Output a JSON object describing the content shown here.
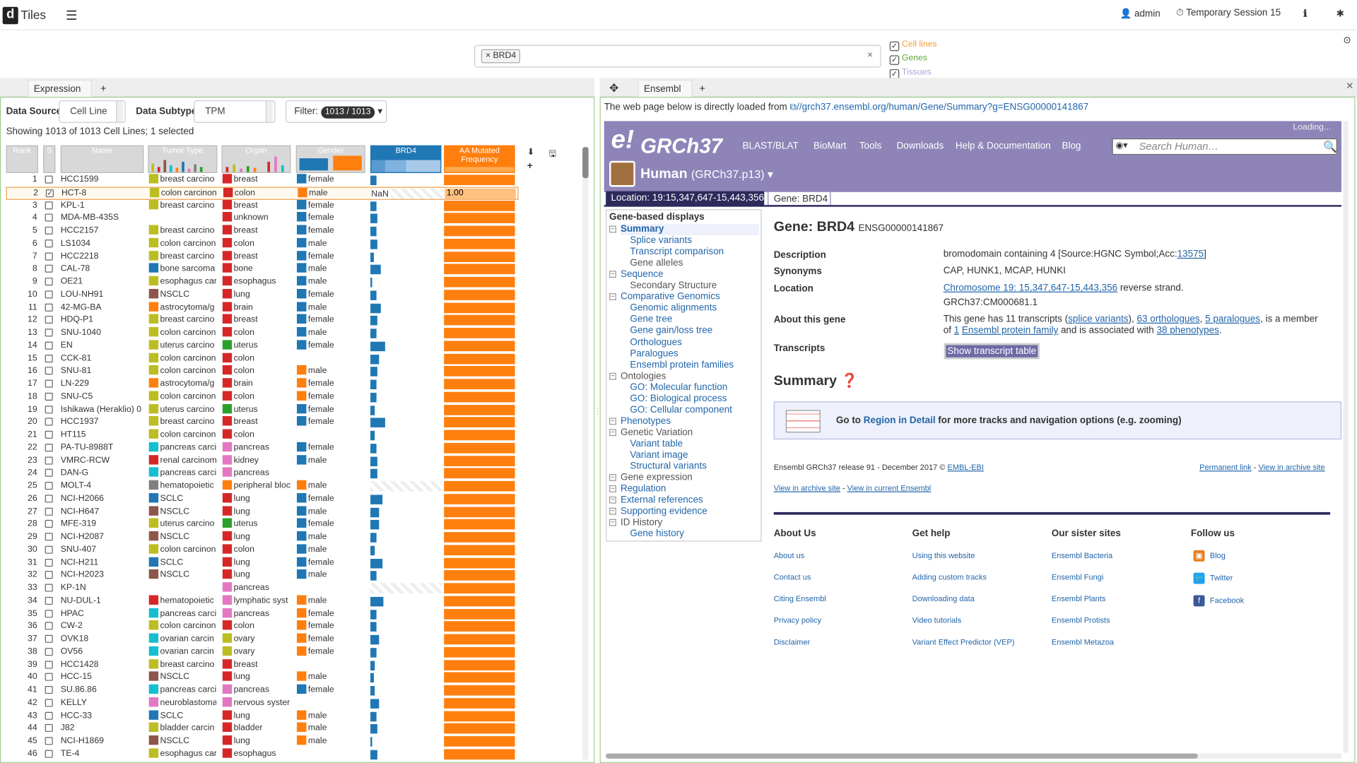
{
  "app": {
    "logo": "d",
    "title": "Tiles",
    "user": "admin",
    "session": "Temporary Session 15"
  },
  "search": {
    "chip": "× BRD4",
    "clear": "×"
  },
  "types": [
    {
      "label": "Cell lines",
      "color": "#f39c3a"
    },
    {
      "label": "Genes",
      "color": "#5aa832"
    },
    {
      "label": "Tissues",
      "color": "#b3a2d8"
    }
  ],
  "left": {
    "tab": "Expression",
    "tab_close": "×",
    "add_tab": "+",
    "datasource_label": "Data Source",
    "datasource_value": "Cell Line",
    "subtype_label": "Data Subtype",
    "subtype_value": "TPM",
    "filter_label": "Filter:",
    "filter_badge": "1013 / 1013",
    "showing": "Showing 1013 of 1013 Cell Lines; 1 selected",
    "columns": [
      "Rank",
      "S",
      "Name",
      "Tumor Type",
      "Organ",
      "Gender",
      "BRD4",
      "AA Mutated Frequency"
    ]
  },
  "rows": [
    {
      "rank": "1",
      "name": "HCC1599",
      "tumor": "breast carcino",
      "tc": "#bcbd22",
      "organ": "breast",
      "oc": "#d62728",
      "gender": "female",
      "gc": "#1f77b4",
      "brd4": 0.08
    },
    {
      "rank": "2",
      "name": "HCT-8",
      "tumor": "colon carcinon",
      "tc": "#bcbd22",
      "organ": "colon",
      "oc": "#d62728",
      "gender": "male",
      "gc": "#ff7f0e",
      "brd4": null,
      "freq": "1.00",
      "sel": true
    },
    {
      "rank": "3",
      "name": "KPL-1",
      "tumor": "breast carcino",
      "tc": "#bcbd22",
      "organ": "breast",
      "oc": "#d62728",
      "gender": "female",
      "gc": "#1f77b4",
      "brd4": 0.08
    },
    {
      "rank": "4",
      "name": "MDA-MB-435S",
      "tumor": "",
      "tc": "",
      "organ": "unknown",
      "oc": "#d62728",
      "gender": "female",
      "gc": "#1f77b4",
      "brd4": 0.1
    },
    {
      "rank": "5",
      "name": "HCC2157",
      "tumor": "breast carcino",
      "tc": "#bcbd22",
      "organ": "breast",
      "oc": "#d62728",
      "gender": "female",
      "gc": "#1f77b4",
      "brd4": 0.09
    },
    {
      "rank": "6",
      "name": "LS1034",
      "tumor": "colon carcinon",
      "tc": "#bcbd22",
      "organ": "colon",
      "oc": "#d62728",
      "gender": "male",
      "gc": "#1f77b4",
      "brd4": 0.1
    },
    {
      "rank": "7",
      "name": "HCC2218",
      "tumor": "breast carcino",
      "tc": "#bcbd22",
      "organ": "breast",
      "oc": "#d62728",
      "gender": "female",
      "gc": "#1f77b4",
      "brd4": 0.05
    },
    {
      "rank": "8",
      "name": "CAL-78",
      "tumor": "bone sarcoma",
      "tc": "#1f77b4",
      "organ": "bone",
      "oc": "#d62728",
      "gender": "male",
      "gc": "#1f77b4",
      "brd4": 0.14
    },
    {
      "rank": "9",
      "name": "OE21",
      "tumor": "esophagus car",
      "tc": "#bcbd22",
      "organ": "esophagus",
      "oc": "#d62728",
      "gender": "male",
      "gc": "#1f77b4",
      "brd4": 0.02
    },
    {
      "rank": "10",
      "name": "LOU-NH91",
      "tumor": "NSCLC",
      "tc": "#8c564b",
      "organ": "lung",
      "oc": "#d62728",
      "gender": "female",
      "gc": "#1f77b4",
      "brd4": 0.08
    },
    {
      "rank": "11",
      "name": "42-MG-BA",
      "tumor": "astrocytoma/g",
      "tc": "#ff7f0e",
      "organ": "brain",
      "oc": "#d62728",
      "gender": "male",
      "gc": "#1f77b4",
      "brd4": 0.15
    },
    {
      "rank": "12",
      "name": "HDQ-P1",
      "tumor": "breast carcino",
      "tc": "#bcbd22",
      "organ": "breast",
      "oc": "#d62728",
      "gender": "female",
      "gc": "#1f77b4",
      "brd4": 0.1
    },
    {
      "rank": "13",
      "name": "SNU-1040",
      "tumor": "colon carcinon",
      "tc": "#bcbd22",
      "organ": "colon",
      "oc": "#d62728",
      "gender": "male",
      "gc": "#1f77b4",
      "brd4": 0.09
    },
    {
      "rank": "14",
      "name": "EN",
      "tumor": "uterus carcino",
      "tc": "#bcbd22",
      "organ": "uterus",
      "oc": "#2ca02c",
      "gender": "female",
      "gc": "#1f77b4",
      "brd4": 0.2
    },
    {
      "rank": "15",
      "name": "CCK-81",
      "tumor": "colon carcinon",
      "tc": "#bcbd22",
      "organ": "colon",
      "oc": "#d62728",
      "gender": "",
      "gc": "",
      "brd4": 0.12
    },
    {
      "rank": "16",
      "name": "SNU-81",
      "tumor": "colon carcinon",
      "tc": "#bcbd22",
      "organ": "colon",
      "oc": "#d62728",
      "gender": "male",
      "gc": "#ff7f0e",
      "brd4": 0.1
    },
    {
      "rank": "17",
      "name": "LN-229",
      "tumor": "astrocytoma/g",
      "tc": "#ff7f0e",
      "organ": "brain",
      "oc": "#d62728",
      "gender": "female",
      "gc": "#ff7f0e",
      "brd4": 0.08
    },
    {
      "rank": "18",
      "name": "SNU-C5",
      "tumor": "colon carcinon",
      "tc": "#bcbd22",
      "organ": "colon",
      "oc": "#d62728",
      "gender": "female",
      "gc": "#ff7f0e",
      "brd4": 0.09
    },
    {
      "rank": "19",
      "name": "Ishikawa (Heraklio) 0",
      "tumor": "uterus carcino",
      "tc": "#bcbd22",
      "organ": "uterus",
      "oc": "#2ca02c",
      "gender": "female",
      "gc": "#1f77b4",
      "brd4": 0.06
    },
    {
      "rank": "20",
      "name": "HCC1937",
      "tumor": "breast carcino",
      "tc": "#bcbd22",
      "organ": "breast",
      "oc": "#d62728",
      "gender": "female",
      "gc": "#1f77b4",
      "brd4": 0.2
    },
    {
      "rank": "21",
      "name": "HT115",
      "tumor": "colon carcinon",
      "tc": "#bcbd22",
      "organ": "colon",
      "oc": "#d62728",
      "gender": "",
      "gc": "",
      "brd4": 0.06
    },
    {
      "rank": "22",
      "name": "PA-TU-8988T",
      "tumor": "pancreas carci",
      "tc": "#17becf",
      "organ": "pancreas",
      "oc": "#e377c2",
      "gender": "female",
      "gc": "#1f77b4",
      "brd4": 0.09
    },
    {
      "rank": "23",
      "name": "VMRC-RCW",
      "tumor": "renal carcinom",
      "tc": "#d62728",
      "organ": "kidney",
      "oc": "#e377c2",
      "gender": "male",
      "gc": "#1f77b4",
      "brd4": 0.1
    },
    {
      "rank": "24",
      "name": "DAN-G",
      "tumor": "pancreas carci",
      "tc": "#17becf",
      "organ": "pancreas",
      "oc": "#e377c2",
      "gender": "",
      "gc": "",
      "brd4": 0.1
    },
    {
      "rank": "25",
      "name": "MOLT-4",
      "tumor": "hematopoietic",
      "tc": "#7f7f7f",
      "organ": "peripheral bloc",
      "oc": "#ff7f0e",
      "gender": "male",
      "gc": "#ff7f0e",
      "brd4": null
    },
    {
      "rank": "26",
      "name": "NCI-H2066",
      "tumor": "SCLC",
      "tc": "#1f77b4",
      "organ": "lung",
      "oc": "#d62728",
      "gender": "female",
      "gc": "#1f77b4",
      "brd4": 0.17
    },
    {
      "rank": "27",
      "name": "NCI-H647",
      "tumor": "NSCLC",
      "tc": "#8c564b",
      "organ": "lung",
      "oc": "#d62728",
      "gender": "male",
      "gc": "#1f77b4",
      "brd4": 0.12
    },
    {
      "rank": "28",
      "name": "MFE-319",
      "tumor": "uterus carcino",
      "tc": "#bcbd22",
      "organ": "uterus",
      "oc": "#2ca02c",
      "gender": "female",
      "gc": "#1f77b4",
      "brd4": 0.12
    },
    {
      "rank": "29",
      "name": "NCI-H2087",
      "tumor": "NSCLC",
      "tc": "#8c564b",
      "organ": "lung",
      "oc": "#d62728",
      "gender": "male",
      "gc": "#1f77b4",
      "brd4": 0.09
    },
    {
      "rank": "30",
      "name": "SNU-407",
      "tumor": "colon carcinon",
      "tc": "#bcbd22",
      "organ": "colon",
      "oc": "#d62728",
      "gender": "male",
      "gc": "#1f77b4",
      "brd4": 0.06
    },
    {
      "rank": "31",
      "name": "NCI-H211",
      "tumor": "SCLC",
      "tc": "#1f77b4",
      "organ": "lung",
      "oc": "#d62728",
      "gender": "female",
      "gc": "#1f77b4",
      "brd4": 0.17
    },
    {
      "rank": "32",
      "name": "NCI-H2023",
      "tumor": "NSCLC",
      "tc": "#8c564b",
      "organ": "lung",
      "oc": "#d62728",
      "gender": "male",
      "gc": "#1f77b4",
      "brd4": 0.09
    },
    {
      "rank": "33",
      "name": "KP-1N",
      "tumor": "",
      "tc": "",
      "organ": "pancreas",
      "oc": "#e377c2",
      "gender": "",
      "gc": "",
      "brd4": null
    },
    {
      "rank": "34",
      "name": "NU-DUL-1",
      "tumor": "hematopoietic",
      "tc": "#d62728",
      "organ": "lymphatic syst",
      "oc": "#e377c2",
      "gender": "male",
      "gc": "#ff7f0e",
      "brd4": 0.18
    },
    {
      "rank": "35",
      "name": "HPAC",
      "tumor": "pancreas carci",
      "tc": "#17becf",
      "organ": "pancreas",
      "oc": "#e377c2",
      "gender": "female",
      "gc": "#ff7f0e",
      "brd4": 0.09
    },
    {
      "rank": "36",
      "name": "CW-2",
      "tumor": "colon carcinon",
      "tc": "#bcbd22",
      "organ": "colon",
      "oc": "#d62728",
      "gender": "female",
      "gc": "#ff7f0e",
      "brd4": 0.08
    },
    {
      "rank": "37",
      "name": "OVK18",
      "tumor": "ovarian carcin",
      "tc": "#17becf",
      "organ": "ovary",
      "oc": "#bcbd22",
      "gender": "female",
      "gc": "#ff7f0e",
      "brd4": 0.12
    },
    {
      "rank": "38",
      "name": "OV56",
      "tumor": "ovarian carcin",
      "tc": "#17becf",
      "organ": "ovary",
      "oc": "#bcbd22",
      "gender": "female",
      "gc": "#ff7f0e",
      "brd4": 0.09
    },
    {
      "rank": "39",
      "name": "HCC1428",
      "tumor": "breast carcino",
      "tc": "#bcbd22",
      "organ": "breast",
      "oc": "#d62728",
      "gender": "",
      "gc": "",
      "brd4": 0.06
    },
    {
      "rank": "40",
      "name": "HCC-15",
      "tumor": "NSCLC",
      "tc": "#8c564b",
      "organ": "lung",
      "oc": "#d62728",
      "gender": "male",
      "gc": "#ff7f0e",
      "brd4": 0.05
    },
    {
      "rank": "41",
      "name": "SU.86.86",
      "tumor": "pancreas carci",
      "tc": "#17becf",
      "organ": "pancreas",
      "oc": "#e377c2",
      "gender": "female",
      "gc": "#1f77b4",
      "brd4": 0.06
    },
    {
      "rank": "42",
      "name": "KELLY",
      "tumor": "neuroblastoma",
      "tc": "#e377c2",
      "organ": "nervous syster",
      "oc": "#e377c2",
      "gender": "",
      "gc": "",
      "brd4": 0.12
    },
    {
      "rank": "43",
      "name": "HCC-33",
      "tumor": "SCLC",
      "tc": "#1f77b4",
      "organ": "lung",
      "oc": "#d62728",
      "gender": "male",
      "gc": "#ff7f0e",
      "brd4": 0.08
    },
    {
      "rank": "44",
      "name": "J82",
      "tumor": "bladder carcin",
      "tc": "#bcbd22",
      "organ": "bladder",
      "oc": "#d62728",
      "gender": "male",
      "gc": "#ff7f0e",
      "brd4": 0.1
    },
    {
      "rank": "45",
      "name": "NCI-H1869",
      "tumor": "NSCLC",
      "tc": "#8c564b",
      "organ": "lung",
      "oc": "#d62728",
      "gender": "male",
      "gc": "#ff7f0e",
      "brd4": 0.02
    },
    {
      "rank": "46",
      "name": "TE-4",
      "tumor": "esophagus car",
      "tc": "#bcbd22",
      "organ": "esophagus",
      "oc": "#d62728",
      "gender": "",
      "gc": "",
      "brd4": 0.1
    }
  ],
  "right": {
    "tab": "Ensembl",
    "tab_close": "×",
    "add_tab": "+",
    "info_prefix": "The web page below is directly loaded from",
    "info_url": "//grch37.ensembl.org/human/Gene/Summary?g=ENSG00000141867"
  },
  "ensembl": {
    "logo_e": "e!",
    "logo_grch": "GRCh37",
    "nav": [
      "BLAST/BLAT",
      "BioMart",
      "Tools",
      "Downloads",
      "Help & Documentation",
      "Blog"
    ],
    "search_placeholder": "Search Human…",
    "loading": "Loading...",
    "species": "Human",
    "assembly": "(GRCh37.p13) ▾",
    "location_tab": "Location: 19:15,347,647-15,443,356",
    "gene_tab": "Gene: BRD4",
    "sidebar_head": "Gene-based displays",
    "sidebar": [
      {
        "t": "Summary",
        "lvl": 0,
        "k": "cur"
      },
      {
        "t": "Splice variants",
        "lvl": 1,
        "k": "link"
      },
      {
        "t": "Transcript comparison",
        "lvl": 1,
        "k": "link"
      },
      {
        "t": "Gene alleles",
        "lvl": 1,
        "k": "grey"
      },
      {
        "t": "Sequence",
        "lvl": 0,
        "k": "link"
      },
      {
        "t": "Secondary Structure",
        "lvl": 1,
        "k": "grey"
      },
      {
        "t": "Comparative Genomics",
        "lvl": 0,
        "k": "link"
      },
      {
        "t": "Genomic alignments",
        "lvl": 1,
        "k": "link"
      },
      {
        "t": "Gene tree",
        "lvl": 1,
        "k": "link"
      },
      {
        "t": "Gene gain/loss tree",
        "lvl": 1,
        "k": "link"
      },
      {
        "t": "Orthologues",
        "lvl": 1,
        "k": "link"
      },
      {
        "t": "Paralogues",
        "lvl": 1,
        "k": "link"
      },
      {
        "t": "Ensembl protein families",
        "lvl": 1,
        "k": "link"
      },
      {
        "t": "Ontologies",
        "lvl": 0,
        "k": "grey"
      },
      {
        "t": "GO: Molecular function",
        "lvl": 1,
        "k": "link"
      },
      {
        "t": "GO: Biological process",
        "lvl": 1,
        "k": "link"
      },
      {
        "t": "GO: Cellular component",
        "lvl": 1,
        "k": "link"
      },
      {
        "t": "Phenotypes",
        "lvl": 0,
        "k": "link"
      },
      {
        "t": "Genetic Variation",
        "lvl": 0,
        "k": "grey"
      },
      {
        "t": "Variant table",
        "lvl": 1,
        "k": "link"
      },
      {
        "t": "Variant image",
        "lvl": 1,
        "k": "link"
      },
      {
        "t": "Structural variants",
        "lvl": 1,
        "k": "link"
      },
      {
        "t": "Gene expression",
        "lvl": 0,
        "k": "grey"
      },
      {
        "t": "Regulation",
        "lvl": 0,
        "k": "link"
      },
      {
        "t": "External references",
        "lvl": 0,
        "k": "link"
      },
      {
        "t": "Supporting evidence",
        "lvl": 0,
        "k": "link"
      },
      {
        "t": "ID History",
        "lvl": 0,
        "k": "grey"
      },
      {
        "t": "Gene history",
        "lvl": 1,
        "k": "link"
      }
    ],
    "gene_title": "Gene: BRD4",
    "gene_id": "ENSG00000141867",
    "desc_k": "Description",
    "desc_v": "bromodomain containing 4 [Source:HGNC Symbol;Acc:",
    "desc_acc": "13575",
    "desc_end": "]",
    "syn_k": "Synonyms",
    "syn_v": "CAP, HUNK1, MCAP, HUNKI",
    "loc_k": "Location",
    "loc_link": "Chromosome 19: 15,347,647-15,443,356",
    "loc_rest": " reverse strand.",
    "loc_v2": "GRCh37:CM000681.1",
    "about_k": "About this gene",
    "about_1": "This gene has 11 transcripts (",
    "about_l1": "splice variants",
    "about_2": "), ",
    "about_l2": "63 orthologues",
    "about_3": ", ",
    "about_l3": "5 paralogues",
    "about_4": ", is a member of ",
    "about_l4": "1",
    "about_l5": "Ensembl protein family",
    "about_5": " and is associated with ",
    "about_l6": "38 phenotypes",
    "about_6": ".",
    "trans_k": "Transcripts",
    "trans_btn": "Show transcript table",
    "summary": "Summary",
    "goto_1": "Go to ",
    "goto_link": "Region in Detail",
    "goto_2": " for more tracks and navigation options (e.g. zooming)",
    "release": "Ensembl GRCh37 release 91 - December 2017 © ",
    "release_link": "EMBL-EBI",
    "perma": "Permanent link",
    "sep": " - ",
    "archive": "View in archive site",
    "archive2": "View in archive site",
    "current": "View in current Ensembl",
    "footer": [
      {
        "h": "About Us",
        "items": [
          "About us",
          "Contact us",
          "Citing Ensembl",
          "Privacy policy",
          "Disclaimer"
        ]
      },
      {
        "h": "Get help",
        "items": [
          "Using this website",
          "Adding custom tracks",
          "Downloading data",
          "Video tutorials",
          "Variant Effect Predictor (VEP)"
        ]
      },
      {
        "h": "Our sister sites",
        "items": [
          "Ensembl Bacteria",
          "Ensembl Fungi",
          "Ensembl Plants",
          "Ensembl Protists",
          "Ensembl Metazoa"
        ]
      },
      {
        "h": "Follow us",
        "items": [
          "Blog",
          "Twitter",
          "Facebook"
        ]
      }
    ]
  }
}
